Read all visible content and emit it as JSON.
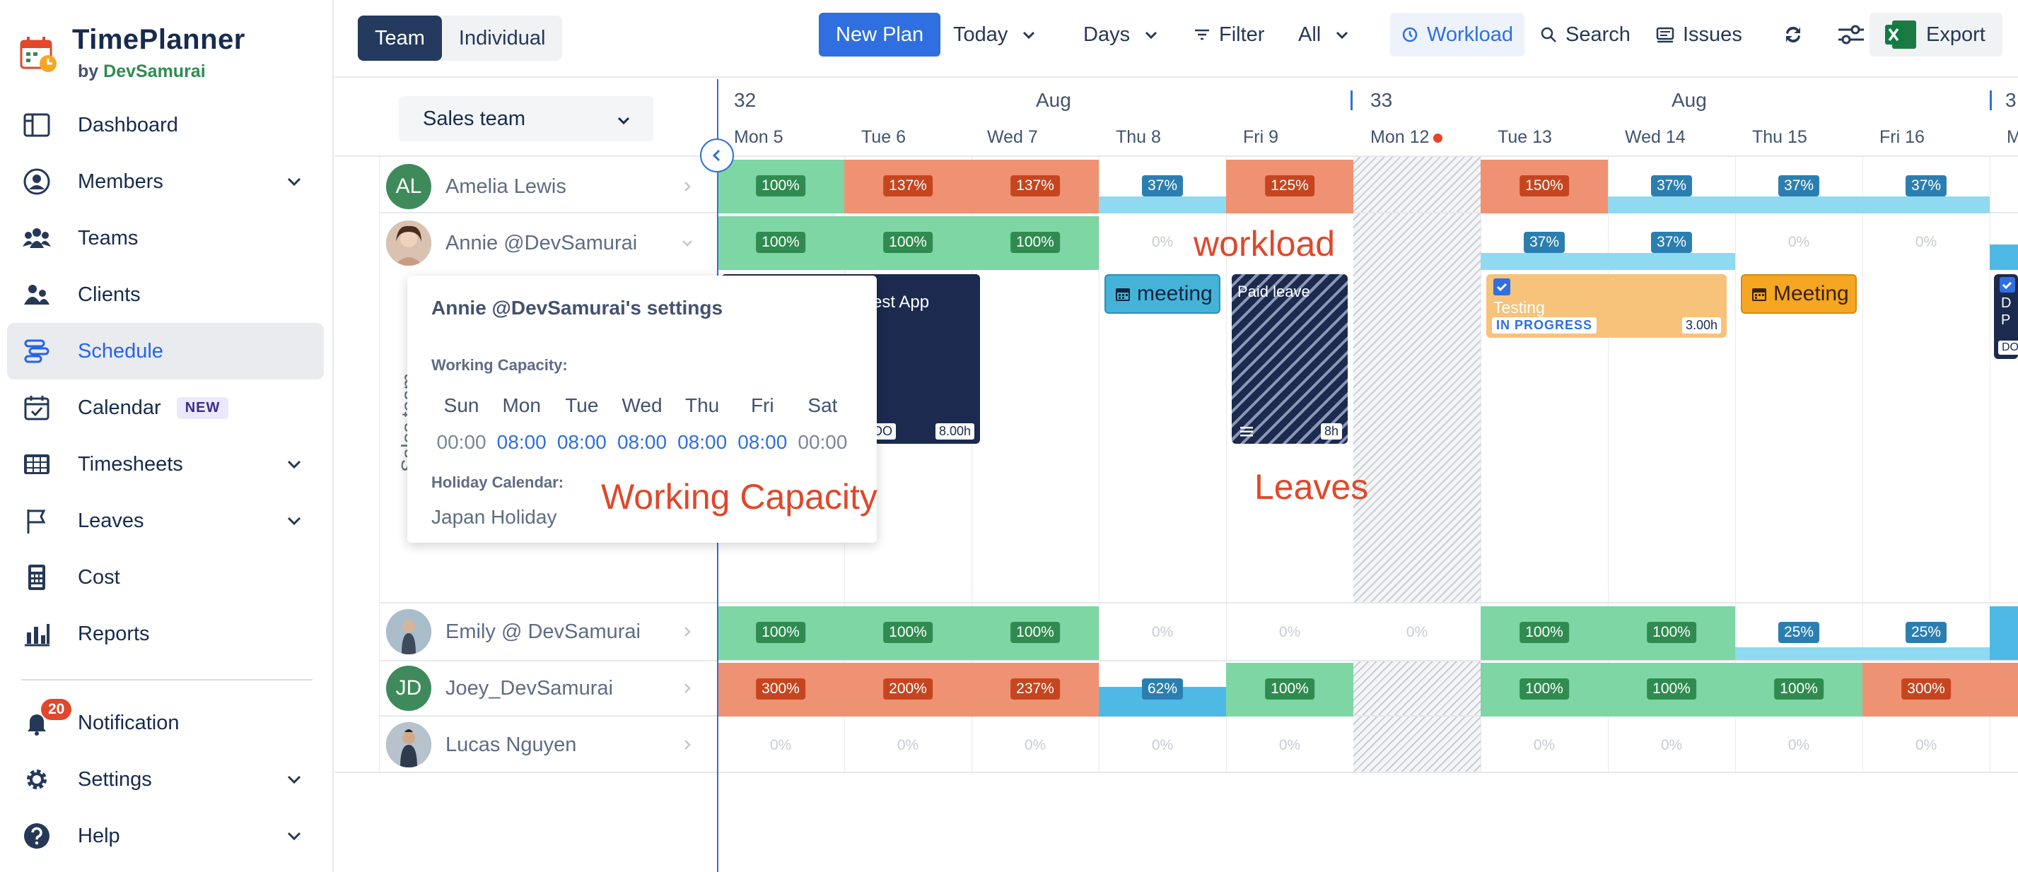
{
  "brand": {
    "title": "TimePlanner",
    "by": "by",
    "company": "DevSamurai"
  },
  "sidebar": {
    "items": [
      {
        "label": "Dashboard",
        "icon": "dashboard-icon"
      },
      {
        "label": "Members",
        "icon": "member-icon"
      },
      {
        "label": "Teams",
        "icon": "teams-icon"
      },
      {
        "label": "Clients",
        "icon": "clients-icon"
      },
      {
        "label": "Schedule",
        "icon": "schedule-icon"
      },
      {
        "label": "Calendar",
        "icon": "calendar-icon",
        "badge": "NEW"
      },
      {
        "label": "Timesheets",
        "icon": "timesheet-icon"
      },
      {
        "label": "Leaves",
        "icon": "flag-icon"
      },
      {
        "label": "Cost",
        "icon": "cost-icon"
      },
      {
        "label": "Reports",
        "icon": "reports-icon"
      }
    ],
    "bottom": [
      {
        "label": "Notification",
        "icon": "bell-icon",
        "count": "20"
      },
      {
        "label": "Settings",
        "icon": "gear-icon"
      },
      {
        "label": "Help",
        "icon": "help-icon"
      }
    ]
  },
  "toolbar": {
    "team": "Team",
    "individual": "Individual",
    "new_plan": "New Plan",
    "today": "Today",
    "days": "Days",
    "filter": "Filter",
    "all": "All",
    "workload": "Workload",
    "search": "Search",
    "issues": "Issues",
    "export": "Export"
  },
  "grid": {
    "team_select": "Sales team",
    "weeks": [
      {
        "num": "32",
        "month": "Aug"
      },
      {
        "num": "33",
        "month": "Aug"
      },
      {
        "num": "3"
      }
    ],
    "days": [
      "Mon 5",
      "Tue 6",
      "Wed 7",
      "Thu 8",
      "Fri 9",
      "Mon 12",
      "Tue 13",
      "Wed 14",
      "Thu 15",
      "Fri 16",
      "M"
    ],
    "team_label": "Sales team",
    "members": [
      {
        "name": "Amelia Lewis",
        "initials": "AL",
        "color": "#3f8a5a"
      },
      {
        "name": "Annie @DevSamurai"
      },
      {
        "name": "Emily @ DevSamurai"
      },
      {
        "name": "Joey_DevSamurai",
        "initials": "JD",
        "color": "#3f8a5a"
      },
      {
        "name": "Lucas Nguyen"
      }
    ],
    "workload": {
      "amelia": [
        "100%",
        "137%",
        "137%",
        "37%",
        "125%",
        "",
        "150%",
        "37%",
        "37%",
        "37%"
      ],
      "annie": [
        "100%",
        "100%",
        "100%",
        "0%",
        "",
        "",
        "37%",
        "37%",
        "0%",
        "0%"
      ],
      "emily": [
        "100%",
        "100%",
        "100%",
        "0%",
        "0%",
        "0%",
        "100%",
        "100%",
        "25%",
        "25%"
      ],
      "joey": [
        "300%",
        "200%",
        "237%",
        "62%",
        "100%",
        "",
        "100%",
        "100%",
        "100%",
        "300%"
      ],
      "lucas": [
        "0%",
        "0%",
        "0%",
        "0%",
        "0%",
        "",
        "0%",
        "0%",
        "0%",
        "0%"
      ]
    },
    "tasks": {
      "test_app": "est App",
      "test_app_status": "DO",
      "test_app_hours": "8.00h",
      "meeting1": "meeting",
      "paid_leave": "Paid leave",
      "paid_leave_hours": "8h",
      "testing": "Testing",
      "testing_status": "IN PROGRESS",
      "testing_hours": "3.00h",
      "meeting2": "Meeting",
      "edge_card_lines": [
        "D",
        "P"
      ],
      "edge_status": "DO"
    }
  },
  "annotations": {
    "workload": "workload",
    "capacity": "Working Capacity",
    "leaves": "Leaves"
  },
  "popup": {
    "title": "Annie @DevSamurai's settings",
    "capacity_label": "Working Capacity:",
    "days": [
      {
        "d": "Sun",
        "h": "00:00"
      },
      {
        "d": "Mon",
        "h": "08:00"
      },
      {
        "d": "Tue",
        "h": "08:00"
      },
      {
        "d": "Wed",
        "h": "08:00"
      },
      {
        "d": "Thu",
        "h": "08:00"
      },
      {
        "d": "Fri",
        "h": "08:00"
      },
      {
        "d": "Sat",
        "h": "00:00"
      }
    ],
    "holiday_label": "Holiday Calendar:",
    "holiday": "Japan Holiday"
  }
}
